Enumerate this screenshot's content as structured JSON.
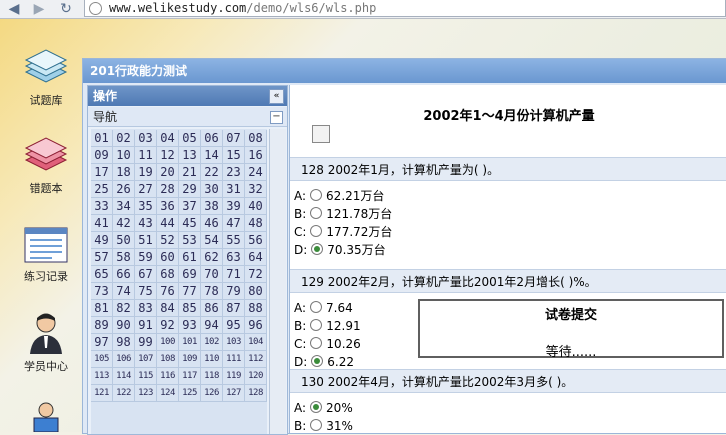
{
  "browser": {
    "url_host": "www.welikestudy.com",
    "url_path": "/demo/wls6/wls.php"
  },
  "sidebar": {
    "items": [
      {
        "label": "试题库",
        "icon": "question-bank-icon"
      },
      {
        "label": "错题本",
        "icon": "wrong-book-icon"
      },
      {
        "label": "练习记录",
        "icon": "practice-record-icon"
      },
      {
        "label": "学员中心",
        "icon": "student-center-icon"
      }
    ]
  },
  "window": {
    "title": "201行政能力测试"
  },
  "panel": {
    "title": "操作",
    "nav_label": "导航",
    "numbers": [
      "01",
      "02",
      "03",
      "04",
      "05",
      "06",
      "07",
      "08",
      "09",
      "10",
      "11",
      "12",
      "13",
      "14",
      "15",
      "16",
      "17",
      "18",
      "19",
      "20",
      "21",
      "22",
      "23",
      "24",
      "25",
      "26",
      "27",
      "28",
      "29",
      "30",
      "31",
      "32",
      "33",
      "34",
      "35",
      "36",
      "37",
      "38",
      "39",
      "40",
      "41",
      "42",
      "43",
      "44",
      "45",
      "46",
      "47",
      "48",
      "49",
      "50",
      "51",
      "52",
      "53",
      "54",
      "55",
      "56",
      "57",
      "58",
      "59",
      "60",
      "61",
      "62",
      "63",
      "64",
      "65",
      "66",
      "67",
      "68",
      "69",
      "70",
      "71",
      "72",
      "73",
      "74",
      "75",
      "76",
      "77",
      "78",
      "79",
      "80",
      "81",
      "82",
      "83",
      "84",
      "85",
      "86",
      "87",
      "88",
      "89",
      "90",
      "91",
      "92",
      "93",
      "94",
      "95",
      "96",
      "97",
      "98",
      "99",
      "100",
      "101",
      "102",
      "103",
      "104",
      "105",
      "106",
      "107",
      "108",
      "109",
      "110",
      "111",
      "112",
      "113",
      "114",
      "115",
      "116",
      "117",
      "118",
      "119",
      "120",
      "121",
      "122",
      "123",
      "124",
      "125",
      "126",
      "127",
      "128"
    ]
  },
  "content": {
    "title": "2002年1～4月份计算机产量",
    "questions": [
      {
        "head": "128 2002年1月，计算机产量为(    )。",
        "options": [
          {
            "letter": "A:",
            "text": "62.21万台",
            "selected": false
          },
          {
            "letter": "B:",
            "text": "121.78万台",
            "selected": false
          },
          {
            "letter": "C:",
            "text": "177.72万台",
            "selected": false
          },
          {
            "letter": "D:",
            "text": "70.35万台",
            "selected": true
          }
        ]
      },
      {
        "head": "129 2002年2月，计算机产量比2001年2月增长(    )%。",
        "options": [
          {
            "letter": "A:",
            "text": "7.64",
            "selected": false
          },
          {
            "letter": "B:",
            "text": "12.91",
            "selected": false
          },
          {
            "letter": "C:",
            "text": "10.26",
            "selected": false
          },
          {
            "letter": "D:",
            "text": "6.22",
            "selected": true
          }
        ]
      },
      {
        "head": "130 2002年4月，计算机产量比2002年3月多(    )。",
        "options": [
          {
            "letter": "A:",
            "text": "20%",
            "selected": true
          },
          {
            "letter": "B:",
            "text": "31%",
            "selected": false
          }
        ]
      }
    ]
  },
  "modal": {
    "title": "试卷提交",
    "message": "等待......"
  }
}
